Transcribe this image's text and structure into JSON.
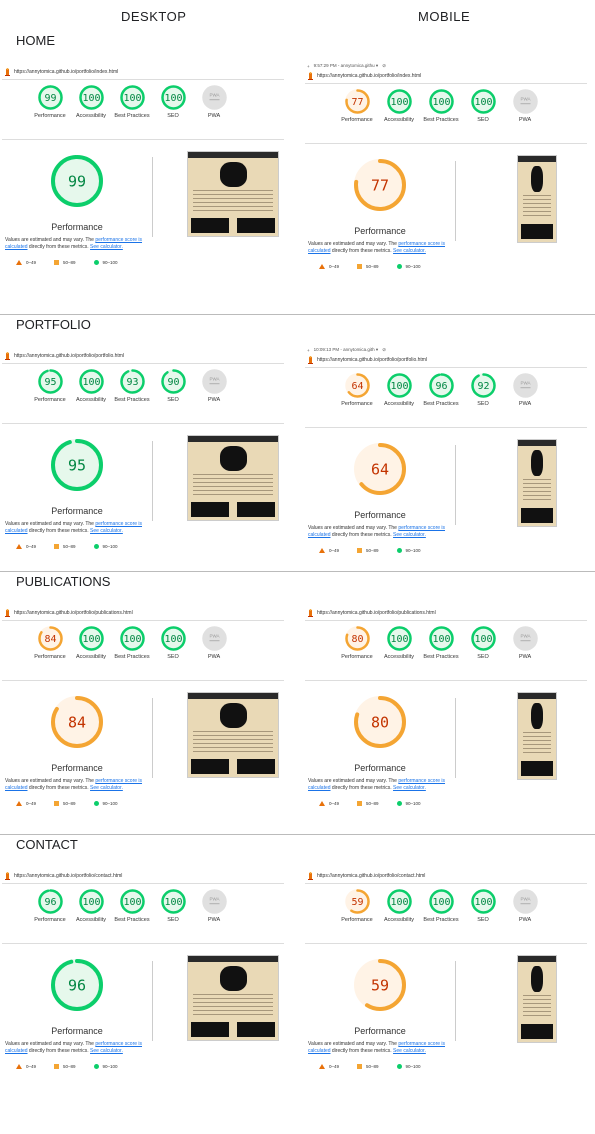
{
  "headers": {
    "desktop": "DESKTOP",
    "mobile": "MOBILE"
  },
  "sections": [
    {
      "title": "HOME",
      "url_desktop": "https://annytomica.github.io/portfolio/index.html",
      "url_mobile": "https://annytomica.github.io/portfolio/index.html",
      "devtime": "9:57:29 PM - annytomica.githu ▾",
      "desktop": {
        "performance": 99,
        "accessibility": 100,
        "best": 100,
        "seo": 100
      },
      "mobile": {
        "performance": 77,
        "accessibility": 100,
        "best": 100,
        "seo": 100
      }
    },
    {
      "title": "PORTFOLIO",
      "url_desktop": "https://annytomica.github.io/portfolio/portfolio.html",
      "url_mobile": "https://annytomica.github.io/portfolio/portfolio.html",
      "devtime": "10:09:13 PM - annytomica.gith ▾",
      "desktop": {
        "performance": 95,
        "accessibility": 100,
        "best": 93,
        "seo": 90
      },
      "mobile": {
        "performance": 64,
        "accessibility": 100,
        "best": 96,
        "seo": 92
      }
    },
    {
      "title": "PUBLICATIONS",
      "url_desktop": "https://annytomica.github.io/portfolio/publications.html",
      "url_mobile": "https://annytomica.github.io/portfolio/publications.html",
      "devtime": "",
      "desktop": {
        "performance": 84,
        "accessibility": 100,
        "best": 100,
        "seo": 100
      },
      "mobile": {
        "performance": 80,
        "accessibility": 100,
        "best": 100,
        "seo": 100
      }
    },
    {
      "title": "CONTACT",
      "url_desktop": "https://annytomica.github.io/portfolio/contact.html",
      "url_mobile": "https://annytomica.github.io/portfolio/contact.html",
      "devtime": "",
      "desktop": {
        "performance": 96,
        "accessibility": 100,
        "best": 100,
        "seo": 100
      },
      "mobile": {
        "performance": 59,
        "accessibility": 100,
        "best": 100,
        "seo": 100
      }
    }
  ],
  "labels": {
    "performance": "Performance",
    "accessibility": "Accessibility",
    "best": "Best Practices",
    "seo": "SEO",
    "pwa": "PWA",
    "pwa_value": "—",
    "big_title": "Performance"
  },
  "note": {
    "pre": "Values are estimated and may vary. The ",
    "link1": "performance score is calculated",
    "mid": " directly from these metrics. ",
    "link2": "See calculator."
  },
  "legend": {
    "red": "0–49",
    "orange": "50–89",
    "green": "90–100"
  },
  "colors": {
    "green": "#0cce6b",
    "green_text": "#018642",
    "green_bg": "#e6f8ec",
    "orange": "#f4a533",
    "orange_text": "#c33300",
    "orange_bg": "#fff3e6",
    "gray": "#e0e0e0"
  }
}
